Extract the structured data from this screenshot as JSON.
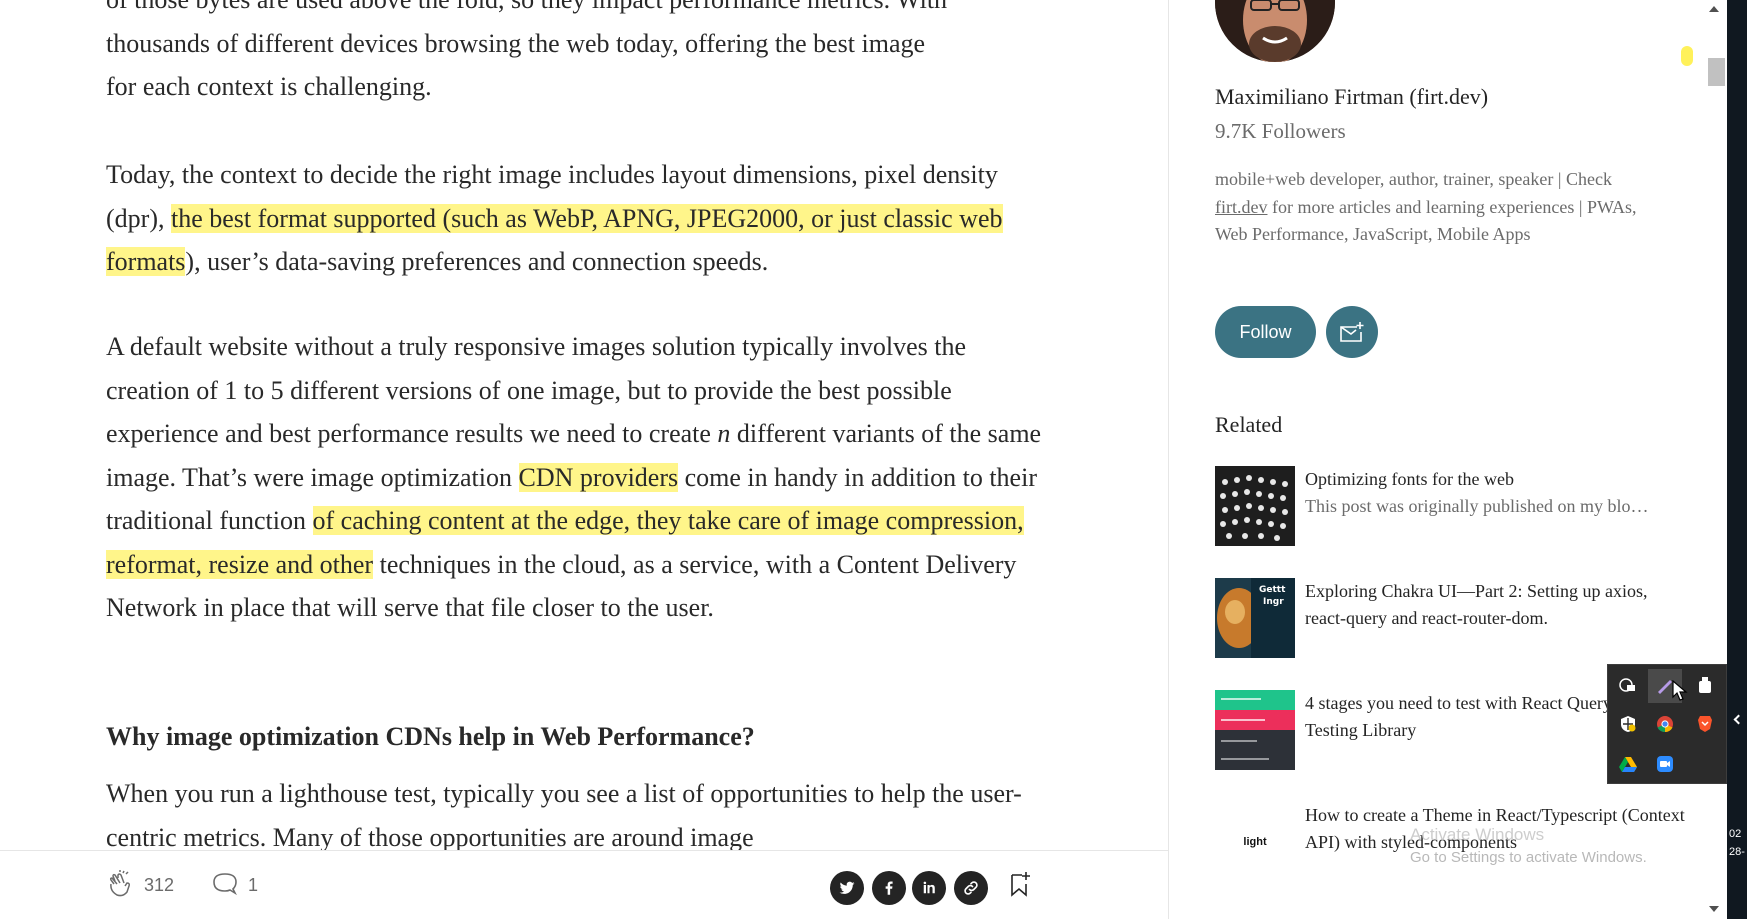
{
  "article": {
    "p0_lines": [
      "of those bytes are used above the fold, so they impact performance metrics. With",
      "thousands of different devices browsing the web today, offering the best image",
      "for each context is challenging."
    ],
    "p1_a": "Today, the context to decide the right image includes layout dimensions, pixel density (dpr), ",
    "p1_hl": "the best format supported (such as WebP, APNG, JPEG2000, or just classic web formats",
    "p1_b": "), user’s data-saving preferences and connection speeds.",
    "p2_a": "A default website without a truly responsive images solution typically involves the creation of 1 to 5 different versions of one image, but to provide the best possible experience and best performance results we need to create ",
    "p2_n": "n",
    "p2_b": " different variants of the same image. That’s were image optimization ",
    "p2_hl1": "CDN providers",
    "p2_c": " come in handy in addition to their traditional function ",
    "p2_hl2": "of caching content at the edge, they take care of image compression, reformat, resize and other",
    "p2_d": " techniques in the cloud, as a service, with a Content Delivery Network in place that will serve that file closer to the user.",
    "heading": "Why image optimization CDNs help in Web Performance?",
    "p3": "When you run a lighthouse test, typically you see a list of opportunities to help the user-centric metrics. Many of those opportunities are around image"
  },
  "actionbar": {
    "claps": "312",
    "responses": "1",
    "share_icons": [
      "twitter-icon",
      "facebook-icon",
      "linkedin-icon",
      "link-icon"
    ],
    "bookmark_icon": "bookmark-add-icon"
  },
  "sidebar": {
    "author_name": "Maximiliano Firtman (firt.dev)",
    "followers": "9.7K Followers",
    "bio_a": "mobile+web developer, author, trainer, speaker | Check ",
    "bio_link": "firt.dev",
    "bio_b": " for more articles and learning experiences | PWAs, Web Performance, JavaScript, Mobile Apps",
    "follow_label": "Follow",
    "related_heading": "Related",
    "related": [
      {
        "title": "Optimizing fonts for the web",
        "subtitle": "This post was originally published on my blo…"
      },
      {
        "title": "Exploring Chakra UI—Part 2: Setting up axios, react-query and react-router-dom.",
        "subtitle": ""
      },
      {
        "title": "4 stages you need to test with React Query + React Testing Library",
        "subtitle": ""
      },
      {
        "title": "How to create a Theme in React/Typescript (Context API) with styled-components",
        "subtitle": ""
      }
    ],
    "related4_thumb_text": "light"
  },
  "overlay": {
    "watermark_title": "Activate Windows",
    "watermark_sub": "Go to Settings to activate Windows.",
    "clock_time": "02",
    "clock_date": "28-"
  },
  "colors": {
    "highlight": "#fff58a",
    "accent": "#3b7383",
    "text": "#292929",
    "muted": "#6b6b6b"
  }
}
